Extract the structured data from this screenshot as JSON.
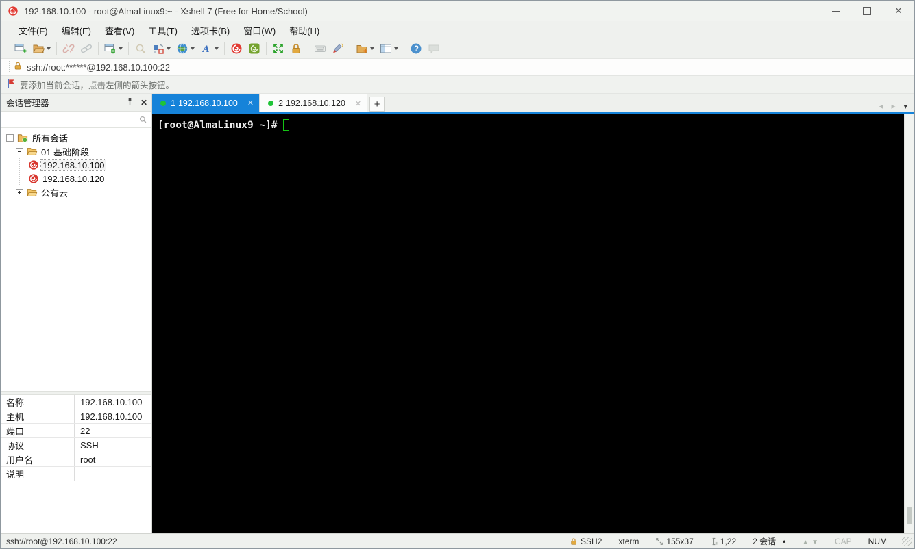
{
  "window": {
    "title": "192.168.10.100 - root@AlmaLinux9:~ - Xshell 7 (Free for Home/School)"
  },
  "menu": {
    "items": [
      "文件(F)",
      "编辑(E)",
      "查看(V)",
      "工具(T)",
      "选项卡(B)",
      "窗口(W)",
      "帮助(H)"
    ]
  },
  "toolbar": {
    "icons": [
      "new-session",
      "open-session",
      "disconnect",
      "reconnect",
      "session-properties",
      "find",
      "window-arrange",
      "encoding-globe",
      "font",
      "xshell",
      "xftp",
      "fullscreen",
      "lock-screen",
      "virtual-keyboard",
      "highlight",
      "new-folder",
      "split-view",
      "help",
      "feedback"
    ]
  },
  "address_bar": {
    "url": "ssh://root:******@192.168.10.100:22"
  },
  "notice_bar": {
    "message": "要添加当前会话，点击左侧的箭头按钮。"
  },
  "sidebar": {
    "title": "会话管理器",
    "search_value": "",
    "tree": [
      {
        "label": "所有会话"
      },
      {
        "label": "01 基础阶段"
      },
      {
        "label": "192.168.10.100"
      },
      {
        "label": "192.168.10.120"
      },
      {
        "label": "公有云"
      }
    ]
  },
  "properties": {
    "rows": [
      {
        "label": "名称",
        "value": "192.168.10.100"
      },
      {
        "label": "主机",
        "value": "192.168.10.100"
      },
      {
        "label": "端口",
        "value": "22"
      },
      {
        "label": "协议",
        "value": "SSH"
      },
      {
        "label": "用户名",
        "value": "root"
      },
      {
        "label": "说明",
        "value": ""
      }
    ]
  },
  "tabs": {
    "items": [
      {
        "number": "1",
        "label": "192.168.10.100"
      },
      {
        "number": "2",
        "label": "192.168.10.120"
      }
    ],
    "new_tab": "+"
  },
  "terminal": {
    "prompt": "[root@AlmaLinux9 ~]#"
  },
  "status_bar": {
    "url": "ssh://root@192.168.10.100:22",
    "protocol": "SSH2",
    "terminal_type": "xterm",
    "size": "155x37",
    "cursor_position": "1,22",
    "sessions": "2 会话",
    "caps": "CAP",
    "num": "NUM"
  },
  "colors": {
    "accent_blue": "#1683d9",
    "tab_green_dot": "#1fc437",
    "terminal_bg": "#000000",
    "terminal_cursor": "#14c314",
    "xshell_red": "#e23b33",
    "chrome_bg": "#eff1ee"
  }
}
